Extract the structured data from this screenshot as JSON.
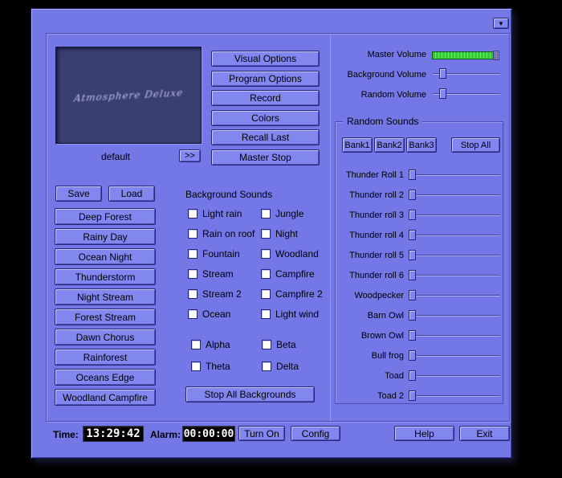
{
  "colors": {
    "purple": "#7477e6",
    "button": "#8286ef",
    "screen": "#3b3e71",
    "green": "#2ecc2e",
    "lcd_text": "#ffffff"
  },
  "titlebar": {
    "menu_glyph": "▼"
  },
  "preview": {
    "screen_text": "Atmosphere Deluxe",
    "preset_name": "default",
    "expand_label": ">>"
  },
  "option_buttons": [
    "Visual Options",
    "Program Options",
    "Record",
    "Colors",
    "Recall Last",
    "Master Stop"
  ],
  "volume": {
    "rows": [
      "Master Volume",
      "Background Volume",
      "Random Volume"
    ]
  },
  "random_sounds": {
    "title": "Random Sounds",
    "banks": [
      "Bank1",
      "Bank2",
      "Bank3"
    ],
    "stop_all": "Stop All",
    "sliders": [
      "Thunder Roll 1",
      "Thunder roll 2",
      "Thunder roll 3",
      "Thunder roll 4",
      "Thunder roll 5",
      "Thunder roll 6",
      "Woodpecker",
      "Barn Owl",
      "Brown Owl",
      "Bull frog",
      "Toad",
      "Toad 2"
    ]
  },
  "presets": {
    "save": "Save",
    "load": "Load",
    "items": [
      "Deep Forest",
      "Rainy Day",
      "Ocean Night",
      "Thunderstorm",
      "Night Stream",
      "Forest Stream",
      "Dawn Chorus",
      "Rainforest",
      "Oceans Edge",
      "Woodland Campfire"
    ]
  },
  "background_sounds": {
    "title": "Background Sounds",
    "col1": [
      "Light rain",
      "Rain on roof",
      "Fountain",
      "Stream",
      "Stream 2",
      "Ocean"
    ],
    "col2": [
      "Jungle",
      "Night",
      "Woodland",
      "Campfire",
      "Campfire 2",
      "Light wind"
    ],
    "waves_col1": [
      "Alpha",
      "Theta"
    ],
    "waves_col2": [
      "Beta",
      "Delta"
    ],
    "stop_all": "Stop All Backgrounds"
  },
  "statusbar": {
    "time_label": "Time:",
    "time_value": "13:29:42",
    "alarm_label": "Alarm:",
    "alarm_value": "00:00:00",
    "turn_on": "Turn On",
    "config": "Config",
    "help": "Help",
    "exit": "Exit"
  }
}
